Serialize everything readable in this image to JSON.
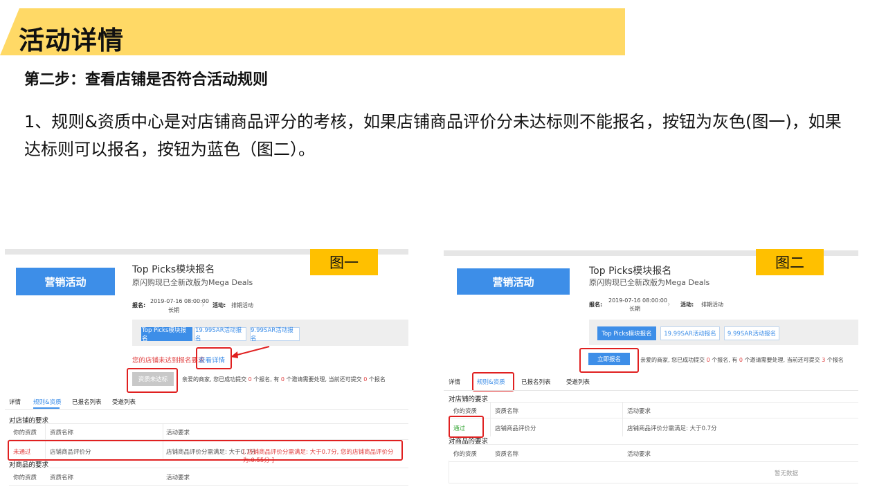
{
  "slide": {
    "title": "活动详情",
    "step": "第二步：查看店铺是否符合活动规则",
    "paragraph": "1、规则&资质中心是对店铺商品评分的考核，如果店铺商品评价分未达标则不能报名，按钮为灰色(图一)，如果达标则可以报名，按钮为蓝色（图二）。"
  },
  "colors": {
    "banner": "#ffd966",
    "tag": "#ffc000",
    "accent": "#3d8ee8",
    "highlight": "#e02020"
  },
  "fig1": {
    "tag": "图一",
    "marketing_button": "营销活动",
    "title": "Top Picks模块报名",
    "subtitle": "原闪购现已全新改版为Mega Deals",
    "signup_label": "报名:",
    "signup_time": "2019-07-16 08:00:00",
    "signup_duration": "长期",
    "activity_label": "活动:",
    "activity_status": "排期活动",
    "tabs": [
      "Top Picks模块报名",
      "19.99SAR活动报名",
      "9.99SAR活动报名"
    ],
    "warning": "您的店铺未达到报名要求",
    "details_link": "查看详情",
    "apply_button": "资质未达标",
    "notice_prefix": "亲爱的商家, 您已成功提交",
    "notice_count1": "0",
    "notice_mid1": "个报名, 有",
    "notice_count2": "0",
    "notice_mid2": "个邀请需要处理, 当前还可提交",
    "notice_count3": "0",
    "notice_suffix": "个报名",
    "nav": [
      "详情",
      "规则&资质",
      "已报名列表",
      "受邀列表"
    ],
    "store_section": "对店铺的要求",
    "headers": [
      "你的资质",
      "资质名称",
      "活动要求"
    ],
    "store_row": {
      "status": "未通过",
      "name": "店铺商品评价分",
      "requirement": "店铺商品评价分需满足: 大于0.7分",
      "detail": "[ 店铺商品评价分需满足: 大于0.7分, 您的店铺商品评价分为:0.55分 ]"
    },
    "product_section": "对商品的要求"
  },
  "fig2": {
    "tag": "图二",
    "marketing_button": "营销活动",
    "title": "Top Picks模块报名",
    "subtitle": "原闪购现已全新改版为Mega Deals",
    "signup_label": "报名:",
    "signup_time": "2019-07-16 08:00:00",
    "signup_duration": "长期",
    "activity_label": "活动:",
    "activity_status": "排期活动",
    "tabs": [
      "Top Picks模块报名",
      "19.99SAR活动报名",
      "9.99SAR活动报名"
    ],
    "apply_button": "立即报名",
    "notice_prefix": "亲爱的商家, 您已成功提交",
    "notice_count1": "0",
    "notice_mid1": "个报名, 有",
    "notice_count2": "0",
    "notice_mid2": "个邀请需要处理, 当前还可提交",
    "notice_count3": "3",
    "notice_suffix": "个报名",
    "nav": [
      "详情",
      "规则&资质",
      "已报名列表",
      "受邀列表"
    ],
    "store_section": "对店铺的要求",
    "headers": [
      "你的资质",
      "资质名称",
      "活动要求"
    ],
    "store_row": {
      "status": "通过",
      "name": "店铺商品评价分",
      "requirement": "店铺商品评价分需满足: 大于0.7分"
    },
    "product_section": "对商品的要求",
    "empty": "暂无数据"
  }
}
